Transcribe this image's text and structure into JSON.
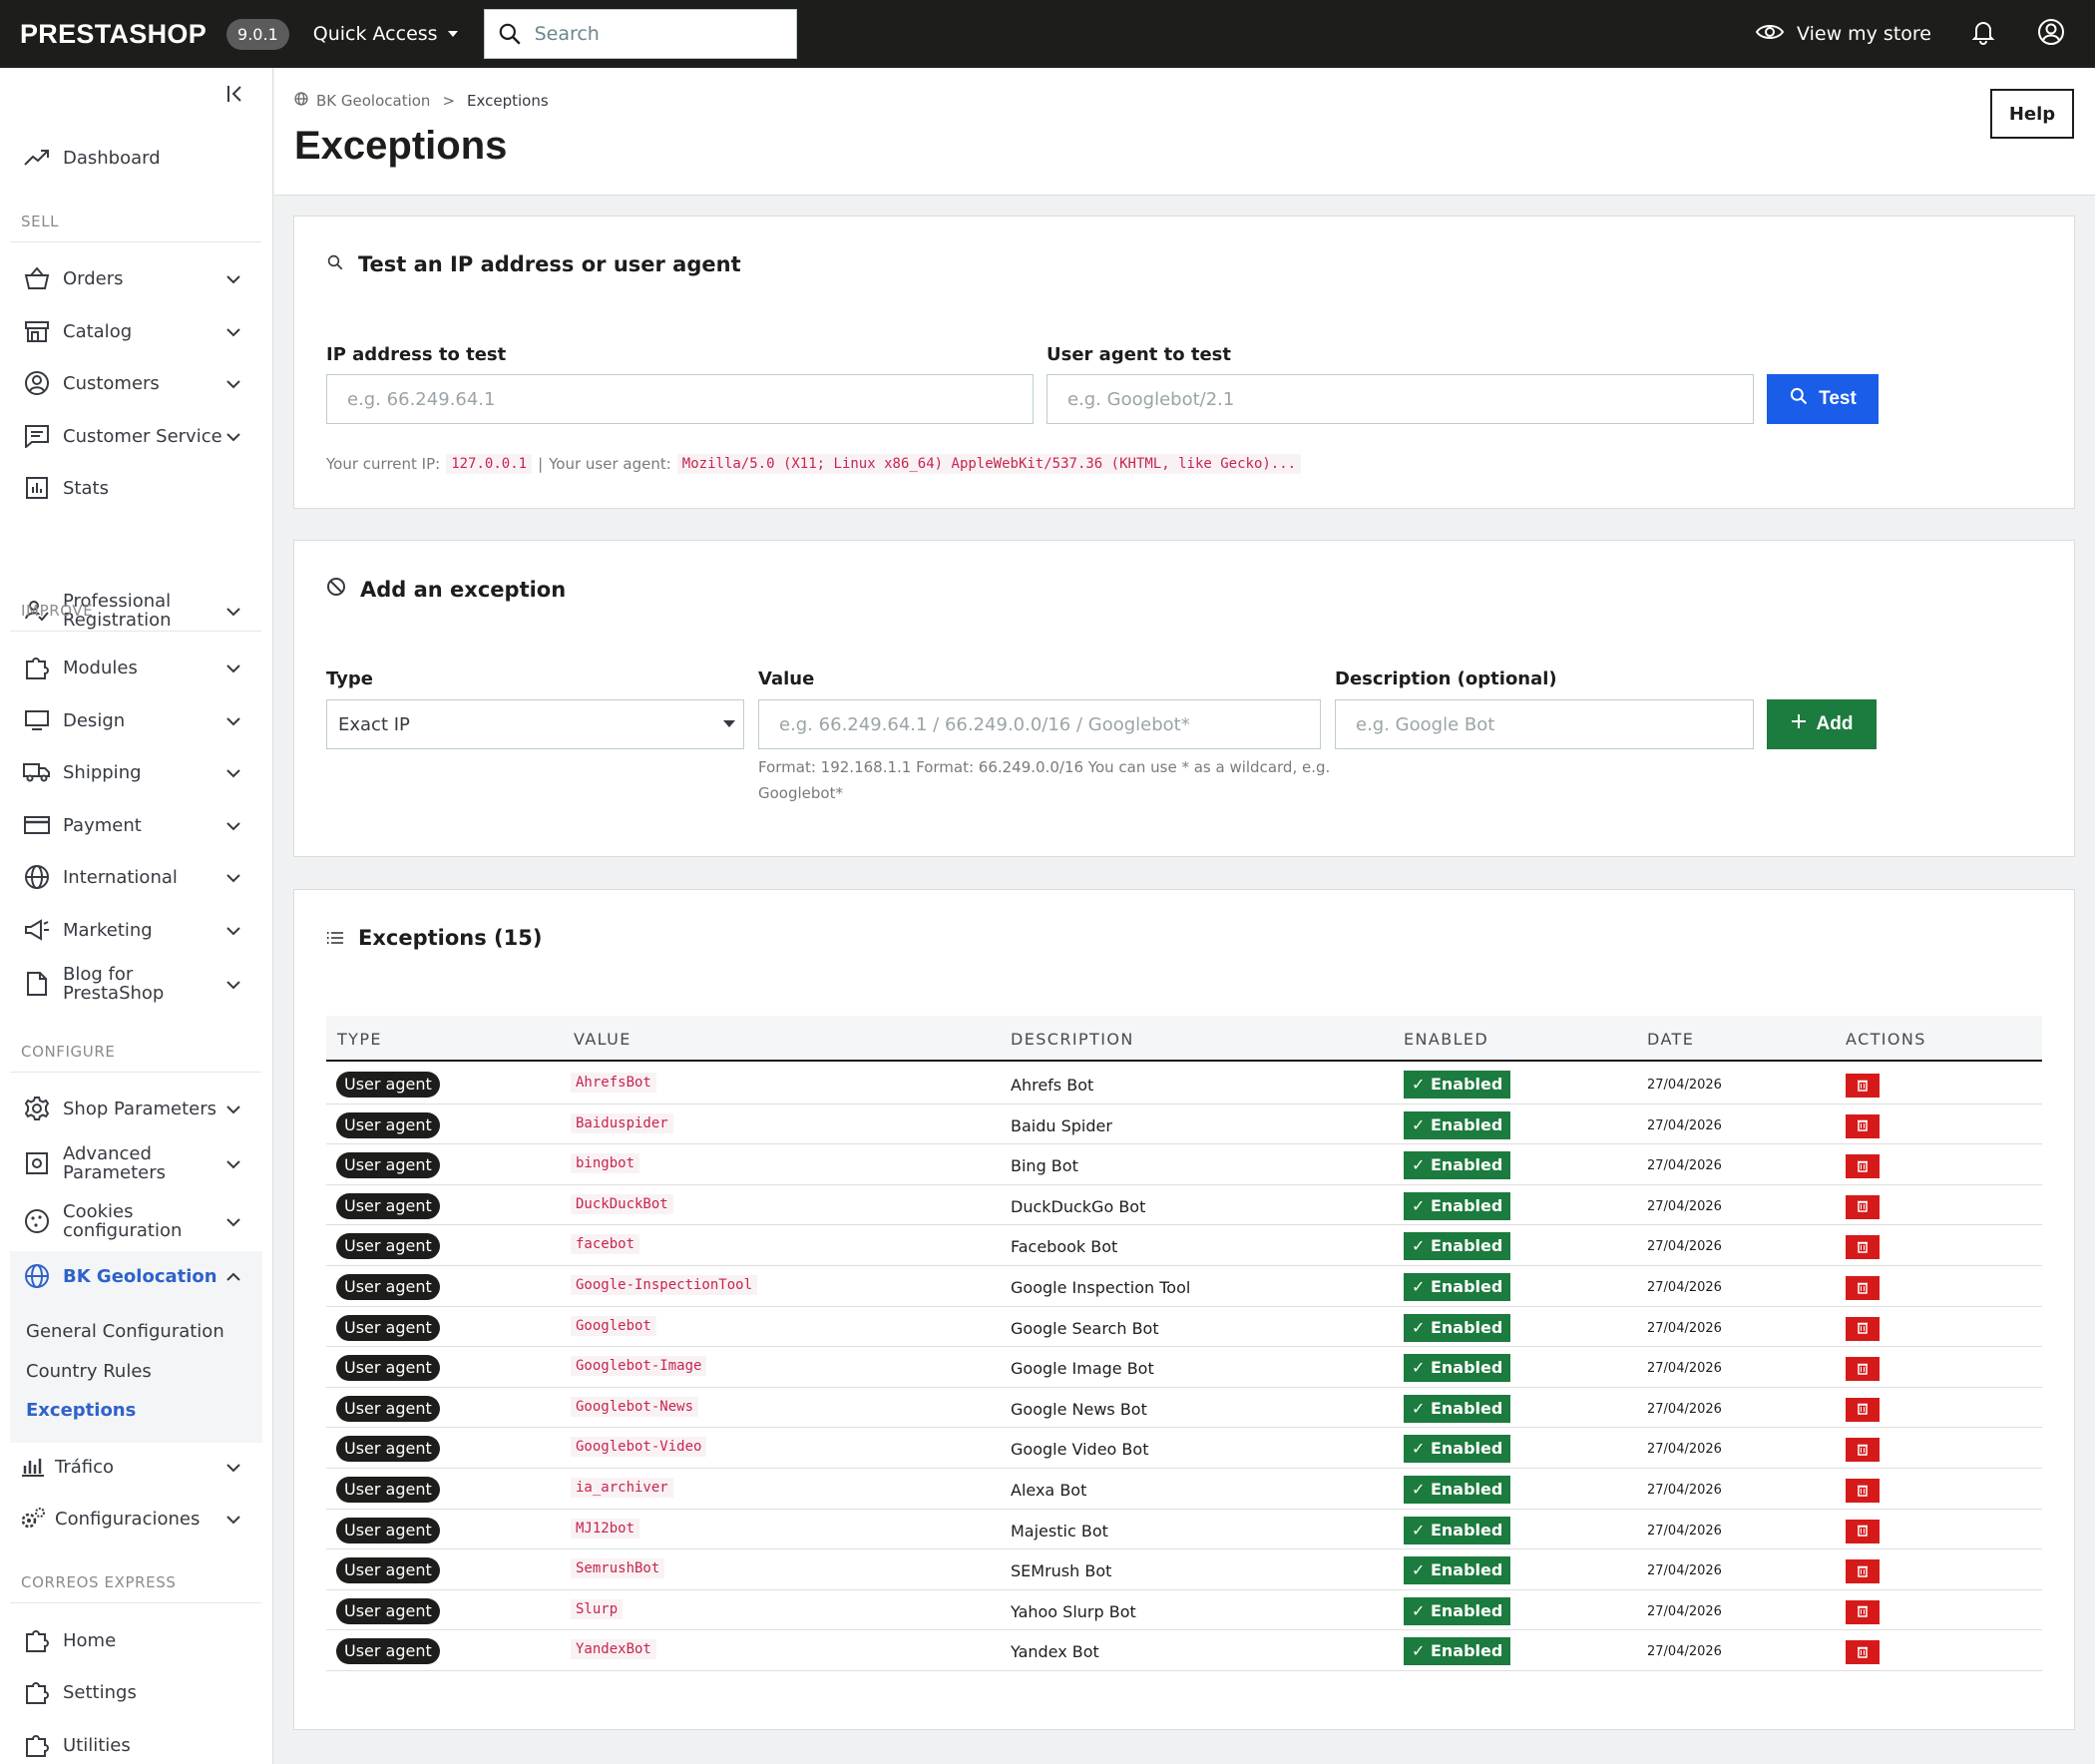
{
  "topbar": {
    "logo": "PRESTASHOP",
    "version": "9.0.1",
    "quick_access": "Quick Access",
    "search_placeholder": "Search",
    "view_store": "View my store"
  },
  "sidebar": {
    "dashboard": "Dashboard",
    "sections": {
      "sell": "SELL",
      "improve": "IMPROVE",
      "configure": "CONFIGURE",
      "correos": "CORREOS EXPRESS"
    },
    "sell_items": [
      "Orders",
      "Catalog",
      "Customers",
      "Customer Service",
      "Stats",
      "Professional",
      "Registration"
    ],
    "improve_items": [
      "Modules",
      "Design",
      "Shipping",
      "Payment",
      "International",
      "Marketing",
      "Blog for",
      "PrestaShop"
    ],
    "configure_items": [
      "Shop Parameters",
      "Advanced",
      "Parameters",
      "Cookies",
      "configuration",
      "BK Geolocation"
    ],
    "bk_sub": [
      "General Configuration",
      "Country Rules",
      "Exceptions"
    ],
    "extra_items": [
      "Tráfico",
      "Configuraciones"
    ],
    "correos_items": [
      "Home",
      "Settings",
      "Utilities"
    ]
  },
  "header": {
    "breadcrumb_parent": "BK Geolocation",
    "breadcrumb_sep": ">",
    "breadcrumb_current": "Exceptions",
    "title": "Exceptions",
    "help": "Help"
  },
  "test_card": {
    "title": "Test an IP address or user agent",
    "ip_label": "IP address to test",
    "ip_placeholder": "e.g. 66.249.64.1",
    "ua_label": "User agent to test",
    "ua_placeholder": "e.g. Googlebot/2.1",
    "button": "Test",
    "current_ip_label": "Your current IP:",
    "current_ip": "127.0.0.1",
    "sep": "|",
    "ua_text_label": "Your user agent:",
    "current_ua": "Mozilla/5.0 (X11; Linux x86_64) AppleWebKit/537.36 (KHTML, like Gecko)..."
  },
  "add_card": {
    "title": "Add an exception",
    "type_label": "Type",
    "type_value": "Exact IP",
    "value_label": "Value",
    "value_placeholder": "e.g. 66.249.64.1 / 66.249.0.0/16 / Googlebot*",
    "hint_line1": "Format: 192.168.1.1 Format: 66.249.0.0/16 You can use * as a wildcard, e.g.",
    "hint_line2": "Googlebot*",
    "desc_label": "Description (optional)",
    "desc_placeholder": "e.g. Google Bot",
    "button": "Add"
  },
  "list_card": {
    "title": "Exceptions (15)",
    "columns": [
      "TYPE",
      "VALUE",
      "DESCRIPTION",
      "ENABLED",
      "DATE",
      "ACTIONS"
    ],
    "rows": [
      {
        "type": "User agent",
        "value": "AhrefsBot",
        "description": "Ahrefs Bot",
        "enabled": "✓ Enabled",
        "date": "27/04/2026"
      },
      {
        "type": "User agent",
        "value": "Baiduspider",
        "description": "Baidu Spider",
        "enabled": "✓ Enabled",
        "date": "27/04/2026"
      },
      {
        "type": "User agent",
        "value": "bingbot",
        "description": "Bing Bot",
        "enabled": "✓ Enabled",
        "date": "27/04/2026"
      },
      {
        "type": "User agent",
        "value": "DuckDuckBot",
        "description": "DuckDuckGo Bot",
        "enabled": "✓ Enabled",
        "date": "27/04/2026"
      },
      {
        "type": "User agent",
        "value": "facebot",
        "description": "Facebook Bot",
        "enabled": "✓ Enabled",
        "date": "27/04/2026"
      },
      {
        "type": "User agent",
        "value": "Google-InspectionTool",
        "description": "Google Inspection Tool",
        "enabled": "✓ Enabled",
        "date": "27/04/2026"
      },
      {
        "type": "User agent",
        "value": "Googlebot",
        "description": "Google Search Bot",
        "enabled": "✓ Enabled",
        "date": "27/04/2026"
      },
      {
        "type": "User agent",
        "value": "Googlebot-Image",
        "description": "Google Image Bot",
        "enabled": "✓ Enabled",
        "date": "27/04/2026"
      },
      {
        "type": "User agent",
        "value": "Googlebot-News",
        "description": "Google News Bot",
        "enabled": "✓ Enabled",
        "date": "27/04/2026"
      },
      {
        "type": "User agent",
        "value": "Googlebot-Video",
        "description": "Google Video Bot",
        "enabled": "✓ Enabled",
        "date": "27/04/2026"
      },
      {
        "type": "User agent",
        "value": "ia_archiver",
        "description": "Alexa Bot",
        "enabled": "✓ Enabled",
        "date": "27/04/2026"
      },
      {
        "type": "User agent",
        "value": "MJ12bot",
        "description": "Majestic Bot",
        "enabled": "✓ Enabled",
        "date": "27/04/2026"
      },
      {
        "type": "User agent",
        "value": "SemrushBot",
        "description": "SEMrush Bot",
        "enabled": "✓ Enabled",
        "date": "27/04/2026"
      },
      {
        "type": "User agent",
        "value": "Slurp",
        "description": "Yahoo Slurp Bot",
        "enabled": "✓ Enabled",
        "date": "27/04/2026"
      },
      {
        "type": "User agent",
        "value": "YandexBot",
        "description": "Yandex Bot",
        "enabled": "✓ Enabled",
        "date": "27/04/2026"
      }
    ]
  },
  "colors": {
    "topbar": "#1d1d1b",
    "primary_blue": "#1a5de8",
    "success_green": "#1c7b3e",
    "danger_red": "#d61a1a",
    "active_nav": "#2f62c9",
    "code_pink": "#c7254e"
  }
}
